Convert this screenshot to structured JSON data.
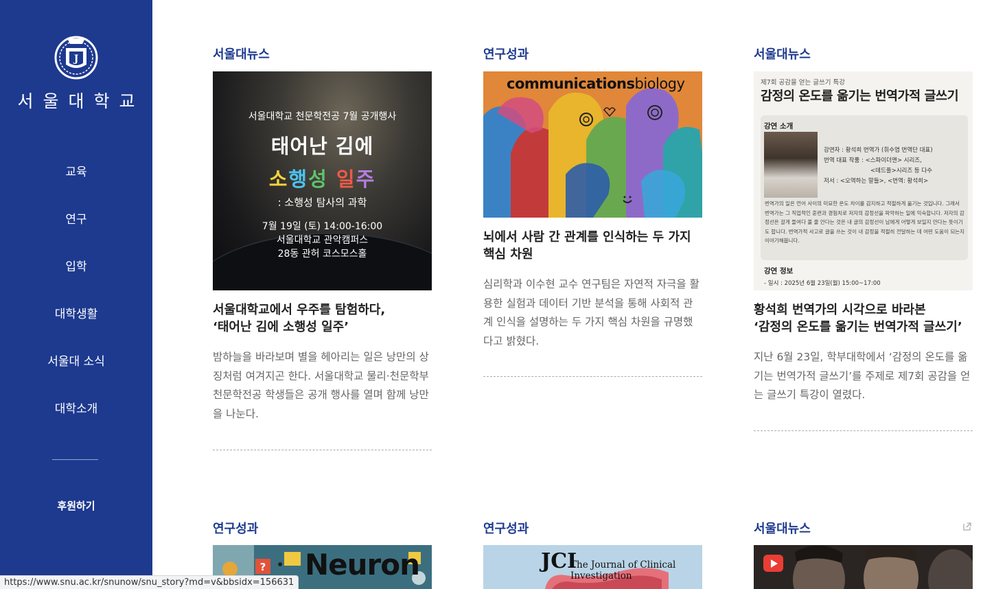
{
  "sidebar": {
    "logo_text": "서울대학교",
    "nav": [
      "교육",
      "연구",
      "입학",
      "대학생활",
      "서울대 소식",
      "대학소개"
    ],
    "donate": "후원하기"
  },
  "cards": [
    {
      "category": "서울대뉴스",
      "headline1": "서울대학교에서 우주를 탐험하다,",
      "headline2": "‘태어난 김에 소행성 일주’",
      "desc": "밤하늘을 바라보며 별을 헤아리는 일은 낭만의 상징처럼 여겨지곤 한다. 서울대학교 물리·천문학부 천문학전공 학생들은 공개 행사를 열며 함께 낭만을 나눈다.",
      "poster": {
        "sub": "서울대학교 천문학전공 7월 공개행사",
        "title": "태어난 김에",
        "rainbow": [
          "소",
          "행",
          "성",
          " ",
          "일",
          "주"
        ],
        "science": ": 소행성 탐사의 과학",
        "info1": "7월 19일 (토) 14:00-16:00",
        "info2": "서울대학교 관악캠퍼스",
        "info3": "28동 관허 코스모스홀"
      }
    },
    {
      "category": "연구성과",
      "headline1": "뇌에서 사람 간 관계를 인식하는 두 가지",
      "headline2": "핵심 차원",
      "desc": "심리학과 이수현 교수 연구팀은 자연적 자극을 활용한 실험과 데이터 기반 분석을 통해 사회적 관계 인식을 설명하는 두 가지 핵심 차원을 규명했다고 밝혔다.",
      "banner_bold": "communications",
      "banner_light": "biology"
    },
    {
      "category": "서울대뉴스",
      "headline1": "황석희 번역가의 시각으로 바라본",
      "headline2": "‘감정의 온도를 옮기는 번역가적 글쓰기’",
      "desc": "지난 6월 23일, 학부대학에서 ‘감정의 온도를 옮기는 번역가적 글쓰기’를 주제로 제7회 공감을 얻는 글쓰기 특강이 열렸다.",
      "poster": {
        "small": "제7회 공감을 얻는 글쓰기 특강",
        "title": "감정의 온도를 옮기는 번역가적 글쓰기",
        "lecture_label": "강연 소개",
        "speaker": "강연자 : 황석희 번역가 (휘수염 번역단 대표)",
        "works1": "번역 대표 작품 : <스파이더맨> 시리즈,",
        "works2": "<데드풀>시리즈 등 다수",
        "books": "저서 : <오역하는 말들>, <번역: 황석희>",
        "para": "번역가의 일은 언어 사이의 미묘한 온도 차이를 감지하고 적절하게 옮기는 것입니다. 그래서 번역가는 그 직업적인 훈련과 경험치로 저자의 감정선을 파악하는 일에 익숙합니다. 저자의 감정선은 갈게 들여다 볼 줄 안다는 것은 내 글의 감정선이 남에게 어떻게 보일지 안다는 뜻이기도 합니다. 번역가적 사고로 글을 쓰는 것이 내 감정을 적절히 전달하는 데 어떤 도움이 되는지 이야기해봅니다.",
        "info_label": "강연 정보",
        "date": "- 일시 : 2025년 6월 23일(월) 15:00~17:00"
      }
    },
    {
      "category": "연구성과",
      "thumb_word": "Neuron"
    },
    {
      "category": "연구성과",
      "thumb_abbr": "JCI",
      "thumb_name": "The Journal of Clinical Investigation"
    },
    {
      "category": "서울대뉴스"
    }
  ],
  "status_url": "https://www.snu.ac.kr/snunow/snu_story?md=v&bbsidx=156631",
  "colors": {
    "brand": "#1d3a8f",
    "sidebar_bg": "#1d3a8f"
  }
}
